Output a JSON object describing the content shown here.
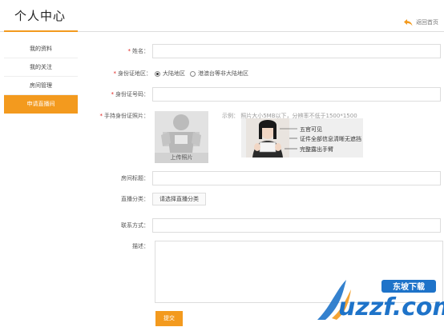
{
  "header": {
    "title": "个人中心",
    "back_label": "返回首页",
    "accent_color": "#f39a1e"
  },
  "sidebar": {
    "items": [
      {
        "label": "我的资料",
        "active": false
      },
      {
        "label": "我的关注",
        "active": false
      },
      {
        "label": "房间管理",
        "active": false
      },
      {
        "label": "申请直播间",
        "active": true
      }
    ]
  },
  "form": {
    "name": {
      "label": "姓名：",
      "required": true,
      "value": ""
    },
    "region": {
      "label": "身份证地区：",
      "required": true,
      "options": [
        "大陆地区",
        "港澳台等非大陆地区"
      ],
      "selected": "大陆地区"
    },
    "id_number": {
      "label": "身份证号码：",
      "required": true,
      "value": ""
    },
    "id_photo": {
      "label": "手持身份证照片：",
      "required": true,
      "upload_label": "上传照片",
      "example_text": "示例：  照片大小5MB以下，分辨率不低于1500*1500",
      "example_notes": [
        "五官可见",
        "证件全部信息清晰无遮挡",
        "完整露出手臂"
      ]
    },
    "room_title": {
      "label": "房间标题：",
      "value": ""
    },
    "category": {
      "label": "直播分类：",
      "button": "请选择直播分类"
    },
    "contact": {
      "label": "联系方式：",
      "value": ""
    },
    "description": {
      "label": "描述：",
      "value": ""
    },
    "submit": "提交"
  },
  "watermark": {
    "badge": "东坡下载",
    "domain": "uzzf.com"
  }
}
